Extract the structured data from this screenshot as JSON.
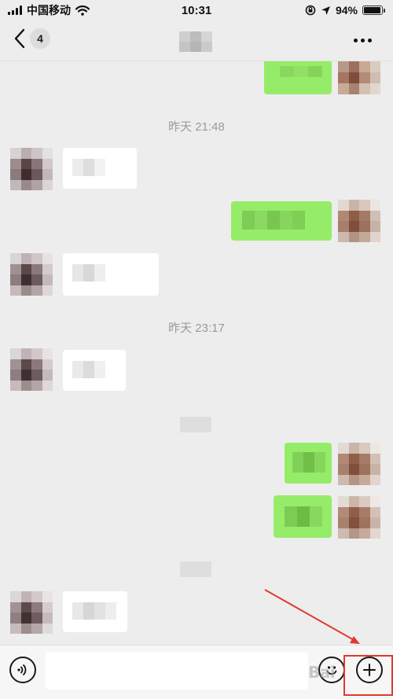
{
  "status_bar": {
    "carrier": "中国移动",
    "time": "10:31",
    "battery": "94%",
    "battery_level": 0.94
  },
  "nav": {
    "unread_count": "4"
  },
  "timestamps": [
    "昨天 21:48",
    "昨天 23:17"
  ],
  "input": {
    "value": "",
    "placeholder": ""
  },
  "watermark": "Bai",
  "colors": {
    "background": "#ededed",
    "outgoing_bubble": "#95ec69",
    "incoming_bubble": "#ffffff",
    "annotation": "#e03a2e"
  },
  "icons": {
    "back": "chevron-left-icon",
    "more": "more-dots-icon",
    "voice": "voice-icon",
    "emoji": "emoji-icon",
    "plus": "plus-icon"
  }
}
